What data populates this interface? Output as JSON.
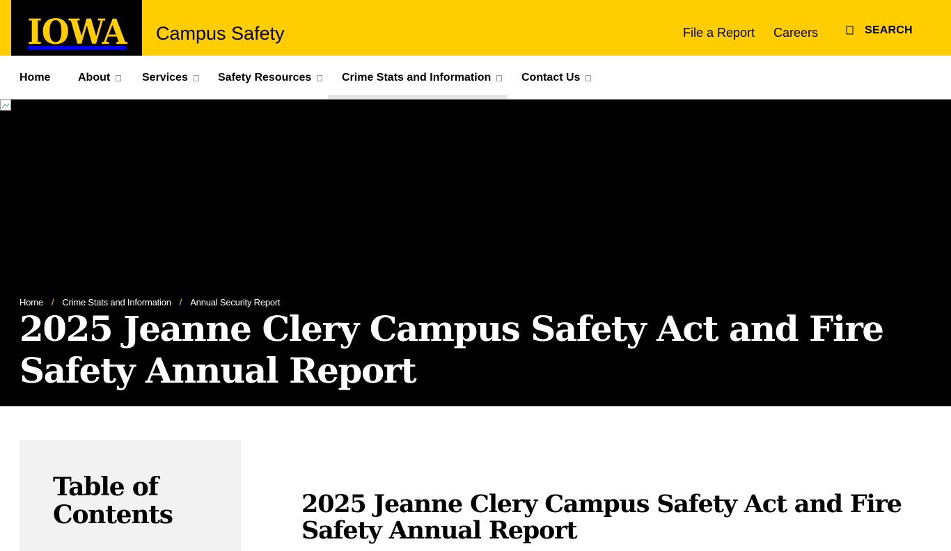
{
  "header": {
    "logo_text": "IOWA",
    "site_title": "Campus Safety",
    "utility_links": [
      "File a Report",
      "Careers"
    ],
    "search_label": "SEARCH",
    "search_icon": "search-icon",
    "brand_yellow": "#FFCD00",
    "brand_black": "#000000"
  },
  "nav": {
    "items": [
      {
        "label": "Home",
        "has_dropdown": false
      },
      {
        "label": "About",
        "has_dropdown": true
      },
      {
        "label": "Services",
        "has_dropdown": true
      },
      {
        "label": "Safety Resources",
        "has_dropdown": true
      },
      {
        "label": "Crime Stats and Information",
        "has_dropdown": true,
        "active": true
      },
      {
        "label": "Contact Us",
        "has_dropdown": true
      }
    ]
  },
  "hero": {
    "breadcrumb": [
      "Home",
      "Crime Stats and Information",
      "Annual Security Report"
    ],
    "title": "2025 Jeanne Clery Campus Safety Act and Fire Safety Annual Report"
  },
  "sidebar": {
    "toc_title": "Table of Contents"
  },
  "main": {
    "title": "2025 Jeanne Clery Campus Safety Act and Fire Safety Annual Report"
  }
}
